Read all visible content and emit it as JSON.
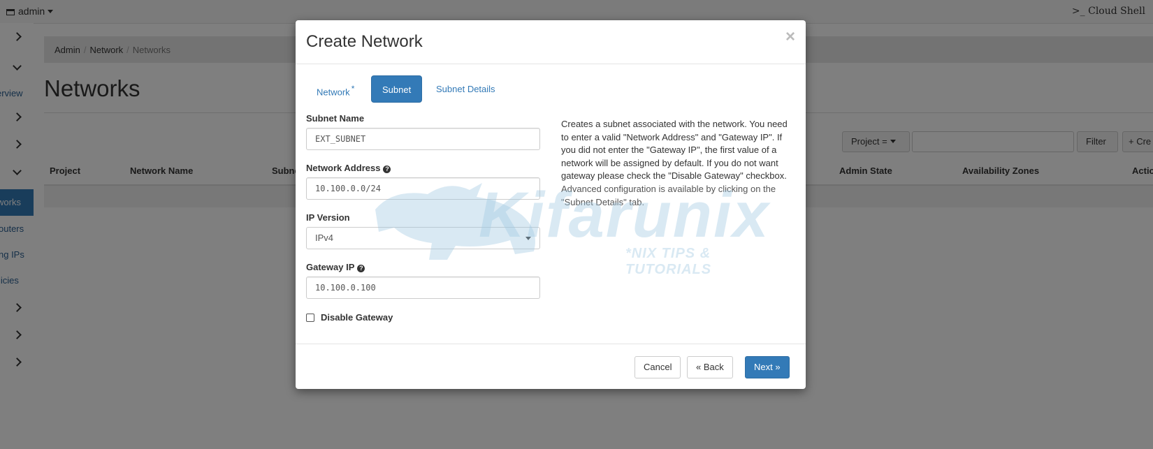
{
  "topbar": {
    "user": "admin",
    "cloud_shell": ">_ Cloud Shell"
  },
  "sidebar": {
    "items": [
      {
        "label": "erview"
      },
      {
        "label": "works"
      },
      {
        "label": "outers"
      },
      {
        "label": "ng IPs"
      },
      {
        "label": "licies"
      }
    ]
  },
  "breadcrumb": {
    "items": [
      "Admin",
      "Network",
      "Networks"
    ]
  },
  "page": {
    "title": "Networks"
  },
  "toolbar": {
    "project_filter": "Project =",
    "filter_button": "Filter",
    "create_button": "+ Cre"
  },
  "table": {
    "headers": [
      "Project",
      "Network Name",
      "Subne",
      "Admin State",
      "Availability Zones",
      "Actio"
    ]
  },
  "modal": {
    "title": "Create Network",
    "close": "×",
    "tabs": [
      {
        "label": "Network",
        "required_mark": "*"
      },
      {
        "label": "Subnet"
      },
      {
        "label": "Subnet Details"
      }
    ],
    "fields": {
      "subnet_name": {
        "label": "Subnet Name",
        "value": "EXT_SUBNET"
      },
      "network_address": {
        "label": "Network Address",
        "value": "10.100.0.0/24"
      },
      "ip_version": {
        "label": "IP Version",
        "value": "IPv4"
      },
      "gateway_ip": {
        "label": "Gateway IP",
        "value": "10.100.0.100"
      },
      "disable_gateway": {
        "label": "Disable Gateway",
        "checked": false
      }
    },
    "help_text": "Creates a subnet associated with the network. You need to enter a valid \"Network Address\" and \"Gateway IP\". If you did not enter the \"Gateway IP\", the first value of a network will be assigned by default. If you do not want gateway please check the \"Disable Gateway\" checkbox.",
    "help_text_muted": "Advanced configuration is available by clicking on the \"Subnet Details\" tab.",
    "buttons": {
      "cancel": "Cancel",
      "back": "«  Back",
      "next": "Next  »"
    },
    "watermark": {
      "brand": "Kifarunix",
      "tagline": "*NIX TIPS & TUTORIALS"
    }
  },
  "colors": {
    "primary": "#337ab7",
    "backdrop": "rgba(0,0,0,0.5)"
  }
}
